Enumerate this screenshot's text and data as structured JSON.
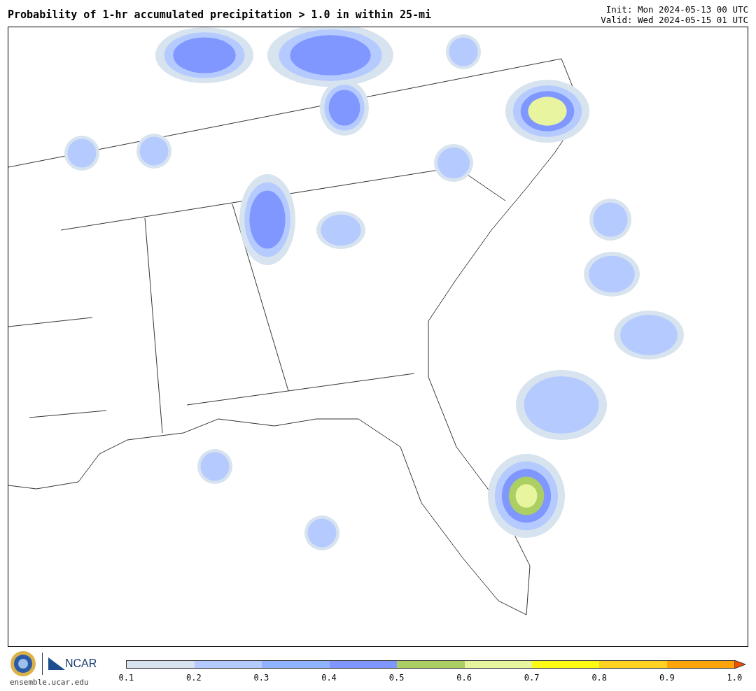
{
  "title": "Probability of 1-hr accumulated precipitation > 1.0 in within 25-mi",
  "init": "Init: Mon 2024-05-13 00 UTC",
  "valid": "Valid: Wed 2024-05-15 01 UTC",
  "footer": {
    "brand": "NCAR",
    "site": "ensemble.ucar.edu"
  },
  "colorbar": {
    "segments": [
      {
        "color": "#d7e3ee"
      },
      {
        "color": "#b5caff"
      },
      {
        "color": "#8fb3ff"
      },
      {
        "color": "#7f97ff"
      },
      {
        "color": "#abcf63"
      },
      {
        "color": "#e8f59e"
      },
      {
        "color": "#fffa14"
      },
      {
        "color": "#ffd121"
      },
      {
        "color": "#ffa30a"
      }
    ],
    "extension": {
      "color": "#f05000"
    },
    "ticks": [
      "0.1",
      "0.2",
      "0.3",
      "0.4",
      "0.5",
      "0.6",
      "0.7",
      "0.8",
      "0.9",
      "1.0"
    ]
  }
}
